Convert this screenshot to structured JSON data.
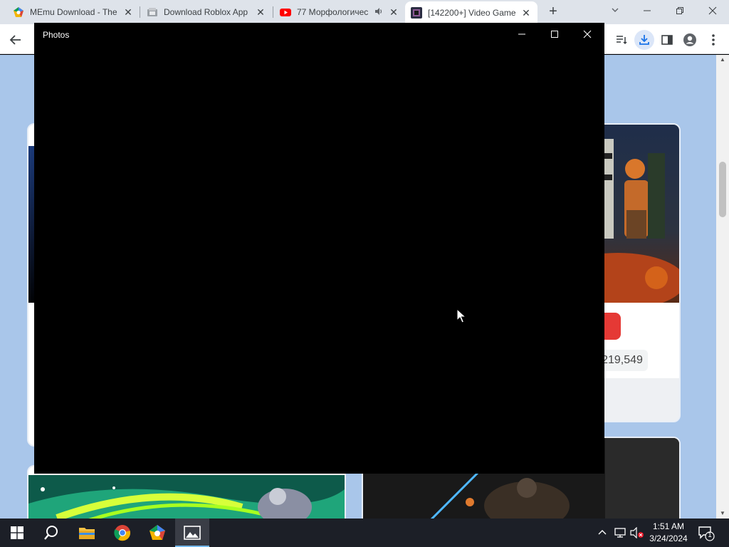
{
  "browser": {
    "tabs": [
      {
        "title": "MEmu Download - The",
        "icon": "memu-pentagon-icon"
      },
      {
        "title": "Download Roblox App",
        "icon": "roblox-app-icon"
      },
      {
        "title": "77 Морфологичес",
        "icon": "youtube-icon",
        "audio_icon": "speaker-icon"
      },
      {
        "title": "[142200+] Video Game",
        "icon": "wallpaper-site-icon",
        "active": true
      }
    ],
    "new_tab_label": "+",
    "colors": {
      "tabstrip": "#dee3ea",
      "active_tab": "#ffffff",
      "page_bg": "#a9c6ea"
    }
  },
  "page": {
    "count_value": "219,549",
    "scroll_top_icon": "arrow-up-icon"
  },
  "photos_window": {
    "title": "Photos",
    "background": "#000000"
  },
  "taskbar": {
    "time": "1:51 AM",
    "date": "3/24/2024",
    "notification_count": "1",
    "pinned": [
      "windows-start-icon",
      "search-icon",
      "file-explorer-icon",
      "chrome-icon",
      "memu-icon",
      "photos-icon"
    ]
  }
}
